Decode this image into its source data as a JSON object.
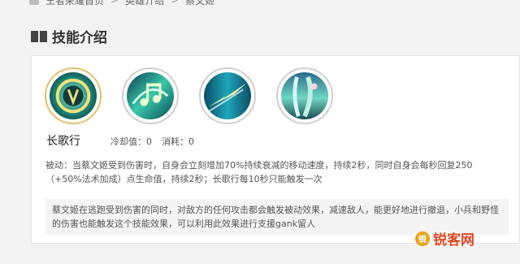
{
  "breadcrumb": {
    "items": [
      "王者荣耀首页",
      "英雄介绍",
      "蔡文姬"
    ],
    "separator": ">"
  },
  "section": {
    "title": "技能介绍",
    "icon": "book-icon"
  },
  "skills": [
    {
      "name": "skill-passive-icon",
      "active": true
    },
    {
      "name": "skill-1-icon",
      "active": false
    },
    {
      "name": "skill-2-icon",
      "active": false
    },
    {
      "name": "skill-3-icon",
      "active": false
    }
  ],
  "skill_detail": {
    "name": "长歌行",
    "cooldown": "冷却值：0",
    "cost": "消耗：0",
    "description": "被动：当蔡文姬受到伤害时，自身会立刻增加70%持续衰减的移动速度，持续2秒，同时自身会每秒回复250（+50%法术加成）点生命值，持续2秒；长歌行每10秒只能触发一次",
    "note": "蔡文姬在逃跑受到伤害的同时，对敌方的任何攻击都会触发被动效果，减速敌人，能更好地进行撤退，小兵和野怪的伤害也能触发这个技能效果，可以利用此效果进行支援gank留人"
  },
  "watermark": {
    "logo": "锐",
    "text": "锐客网"
  },
  "colors": {
    "accent": "#e3c16b",
    "watermark": "#e2471f"
  }
}
